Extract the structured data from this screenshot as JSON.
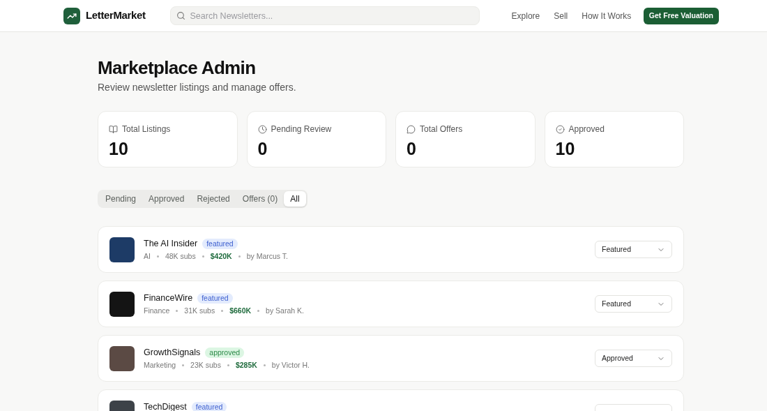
{
  "header": {
    "brand": "LetterMarket",
    "search": {
      "placeholder": "Search Newsletters..."
    },
    "nav": [
      "Explore",
      "Sell",
      "How It Works"
    ],
    "cta": "Get Free Valuation"
  },
  "page": {
    "title": "Marketplace Admin",
    "subtitle": "Review newsletter listings and manage offers."
  },
  "stats": [
    {
      "label": "Total Listings",
      "value": "10"
    },
    {
      "label": "Pending Review",
      "value": "0"
    },
    {
      "label": "Total Offers",
      "value": "0"
    },
    {
      "label": "Approved",
      "value": "10"
    }
  ],
  "tabs": [
    {
      "label": "Pending",
      "selected": false
    },
    {
      "label": "Approved",
      "selected": false
    },
    {
      "label": "Rejected",
      "selected": false
    },
    {
      "label": "Offers (0)",
      "selected": false
    },
    {
      "label": "All",
      "selected": true
    }
  ],
  "listings": [
    {
      "name": "The AI Insider",
      "badge": {
        "text": "featured",
        "kind": "featured"
      },
      "meta": {
        "category": "AI",
        "subscribers": "48K subs",
        "price": "$420K",
        "author": "by Marcus T."
      },
      "status": "Featured"
    },
    {
      "name": "FinanceWire",
      "badge": {
        "text": "featured",
        "kind": "featured"
      },
      "meta": {
        "category": "Finance",
        "subscribers": "31K subs",
        "price": "$660K",
        "author": "by Sarah K."
      },
      "status": "Featured"
    },
    {
      "name": "GrowthSignals",
      "badge": {
        "text": "approved",
        "kind": "approved"
      },
      "meta": {
        "category": "Marketing",
        "subscribers": "23K subs",
        "price": "$285K",
        "author": "by Victor H."
      },
      "status": "Approved"
    },
    {
      "name": "TechDigest",
      "badge": {
        "text": "featured",
        "kind": "featured"
      }
    }
  ]
}
